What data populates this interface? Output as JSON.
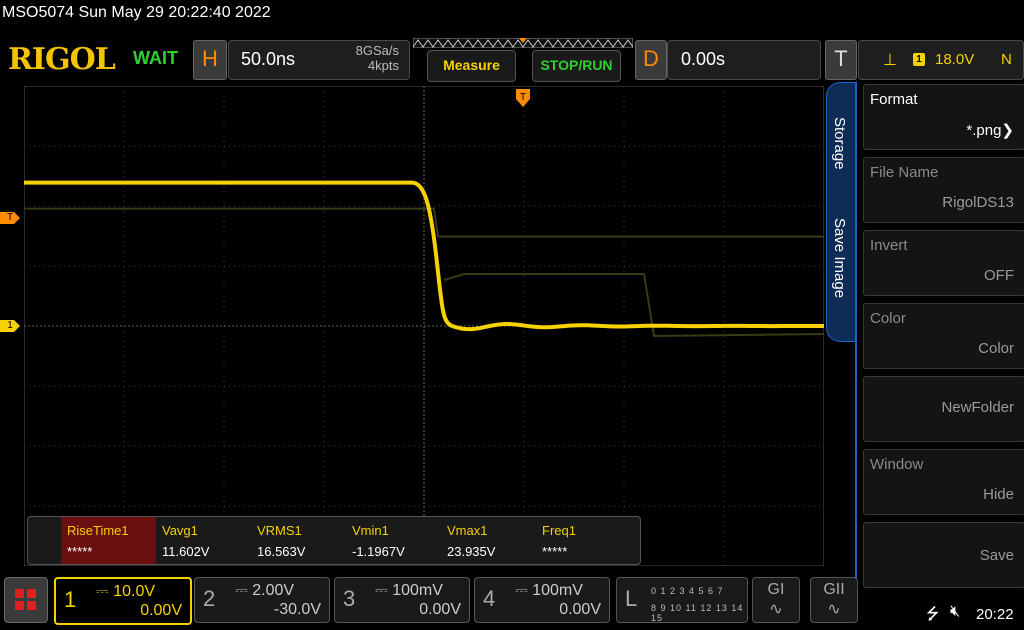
{
  "title": "MSO5074  Sun May 29 20:22:40 2022",
  "top": {
    "logo": "RIGOL",
    "run_state": "WAIT",
    "h_letter": "H",
    "timebase": "50.0ns",
    "sample_rate": "8GSa/s",
    "memory_depth": "4kpts",
    "measure_label": "Measure",
    "stoprun_label": "STOP/RUN",
    "d_letter": "D",
    "delay": "0.00s",
    "t_letter": "T",
    "trigger_channel": "1",
    "trigger_level": "18.0V",
    "trigger_mode": "N"
  },
  "screen": {
    "trigger_marker": "T",
    "ch1_marker": "1",
    "trigger_pos_marker": "T"
  },
  "measurements": [
    {
      "name": "RiseTime1",
      "value": "*****"
    },
    {
      "name": "Vavg1",
      "value": "11.602V"
    },
    {
      "name": "VRMS1",
      "value": "16.563V"
    },
    {
      "name": "Vmin1",
      "value": "-1.1967V"
    },
    {
      "name": "Vmax1",
      "value": "23.935V"
    },
    {
      "name": "Freq1",
      "value": "*****"
    }
  ],
  "menu": {
    "tab_storage": "Storage",
    "tab_save_image": "Save Image",
    "items": [
      {
        "label": "Format",
        "value": "*.png"
      },
      {
        "label": "File Name",
        "value": "RigolDS13"
      },
      {
        "label": "Invert",
        "value": "OFF"
      },
      {
        "label": "Color",
        "value": "Color"
      },
      {
        "label": "",
        "value": "NewFolder"
      },
      {
        "label": "Window",
        "value": "Hide"
      },
      {
        "label": "",
        "value": "Save"
      }
    ]
  },
  "channels": [
    {
      "num": "1",
      "scale": "10.0V",
      "offset": "0.00V",
      "active": true,
      "color": "#f5d200"
    },
    {
      "num": "2",
      "scale": "2.00V",
      "offset": "-30.0V"
    },
    {
      "num": "3",
      "scale": "100mV",
      "offset": "0.00V"
    },
    {
      "num": "4",
      "scale": "100mV",
      "offset": "0.00V"
    }
  ],
  "logic": {
    "letter": "L",
    "row1": "0 1 2 3  4 5 6 7",
    "row2": "8 9 10 11 12 13 14 15"
  },
  "gen1": "GI",
  "gen2": "GII",
  "clock": "20:22",
  "waveform": {
    "channel": "1",
    "color": "#f5d200",
    "high_level_v": 23.9,
    "low_level_v": 0,
    "edge": "falling",
    "edge_time_div": 0
  }
}
